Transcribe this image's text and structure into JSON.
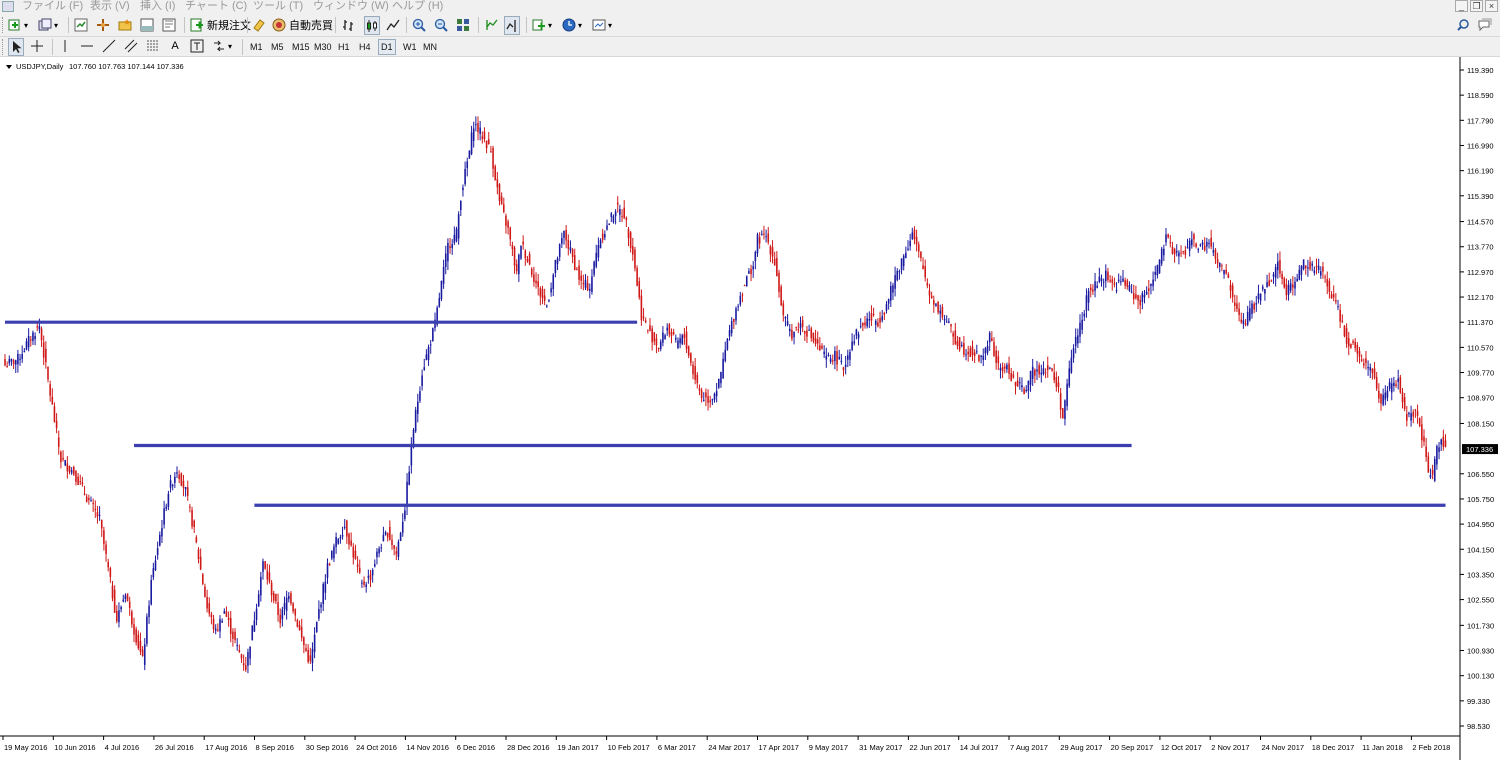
{
  "menu": {
    "items": [
      "ファイル (F)",
      "表示 (V)",
      "挿入 (I)",
      "チャート (C)",
      "ツール (T)",
      "ウィンドウ (W)",
      "ヘルプ (H)"
    ]
  },
  "toolbar": {
    "new_order_label": "新規注文",
    "auto_trade_label": "自動売買",
    "timeframes": [
      "M1",
      "M5",
      "M15",
      "M30",
      "H1",
      "H4",
      "D1",
      "W1",
      "MN"
    ],
    "active_timeframe": "D1"
  },
  "chart_header": {
    "symbol_text": "USDJPY,Daily",
    "ohlc_text": "107.760 107.763 107.144 107.336"
  },
  "colors": {
    "bull": "#1a1aa0",
    "bear": "#d01818",
    "level_line": "#3b3fb0",
    "price_label_bg": "#000000"
  },
  "chart_data": {
    "type": "candlestick",
    "symbol": "USDJPY",
    "timeframe": "Daily",
    "last_price": 107.336,
    "y_ticks": [
      119.39,
      118.59,
      117.79,
      116.99,
      116.19,
      115.39,
      114.57,
      113.77,
      112.97,
      112.17,
      111.37,
      110.57,
      109.77,
      108.97,
      108.15,
      107.336,
      106.55,
      105.75,
      104.95,
      104.15,
      103.35,
      102.55,
      101.73,
      100.93,
      100.13,
      99.33,
      98.53
    ],
    "y_tick_labels": [
      "119.390",
      "118.590",
      "117.790",
      "116.990",
      "116.190",
      "115.390",
      "114.570",
      "113.770",
      "112.970",
      "112.170",
      "111.370",
      "110.570",
      "109.770",
      "108.970",
      "108.150",
      "107.336",
      "106.550",
      "105.750",
      "104.950",
      "104.150",
      "103.350",
      "102.550",
      "101.730",
      "100.930",
      "100.130",
      "99.330",
      "98.530"
    ],
    "x_labels": [
      "19 May 2016",
      "10 Jun 2016",
      "4 Jul 2016",
      "26 Jul 2016",
      "17 Aug 2016",
      "8 Sep 2016",
      "30 Sep 2016",
      "24 Oct 2016",
      "14 Nov 2016",
      "6 Dec 2016",
      "28 Dec 2016",
      "19 Jan 2017",
      "10 Feb 2017",
      "6 Mar 2017",
      "24 Mar 2017",
      "17 Apr 2017",
      "9 May 2017",
      "31 May 2017",
      "22 Jun 2017",
      "14 Jul 2017",
      "7 Aug 2017",
      "29 Aug 2017",
      "20 Sep 2017",
      "12 Oct 2017",
      "2 Nov 2017",
      "24 Nov 2017",
      "18 Dec 2017",
      "11 Jan 2018",
      "2 Feb 2018"
    ],
    "ylim": [
      98.53,
      119.39
    ],
    "path_points": [
      [
        0,
        110.0
      ],
      [
        6,
        110.2
      ],
      [
        12,
        110.9
      ],
      [
        16,
        111.25
      ],
      [
        20,
        109.5
      ],
      [
        26,
        107.0
      ],
      [
        32,
        106.6
      ],
      [
        38,
        105.8
      ],
      [
        44,
        105.1
      ],
      [
        48,
        103.5
      ],
      [
        52,
        101.9
      ],
      [
        56,
        102.8
      ],
      [
        60,
        101.6
      ],
      [
        64,
        100.6
      ],
      [
        68,
        103.1
      ],
      [
        72,
        104.6
      ],
      [
        76,
        106.0
      ],
      [
        80,
        106.7
      ],
      [
        84,
        106.0
      ],
      [
        88,
        104.7
      ],
      [
        94,
        102.3
      ],
      [
        98,
        101.5
      ],
      [
        102,
        102.2
      ],
      [
        108,
        101.0
      ],
      [
        112,
        100.4
      ],
      [
        116,
        102.0
      ],
      [
        120,
        103.7
      ],
      [
        124,
        102.8
      ],
      [
        128,
        101.9
      ],
      [
        132,
        102.8
      ],
      [
        138,
        101.3
      ],
      [
        142,
        100.5
      ],
      [
        146,
        102.2
      ],
      [
        150,
        103.6
      ],
      [
        154,
        104.4
      ],
      [
        158,
        104.9
      ],
      [
        162,
        104.0
      ],
      [
        166,
        103.0
      ],
      [
        170,
        103.3
      ],
      [
        174,
        104.2
      ],
      [
        178,
        104.7
      ],
      [
        182,
        104.0
      ],
      [
        186,
        105.5
      ],
      [
        190,
        108.0
      ],
      [
        194,
        109.8
      ],
      [
        196,
        110.3
      ],
      [
        200,
        111.3
      ],
      [
        203,
        112.6
      ],
      [
        206,
        113.8
      ],
      [
        210,
        114.2
      ],
      [
        212,
        115.4
      ],
      [
        216,
        116.8
      ],
      [
        218,
        117.7
      ],
      [
        222,
        117.3
      ],
      [
        226,
        116.8
      ],
      [
        230,
        115.2
      ],
      [
        234,
        114.3
      ],
      [
        238,
        112.9
      ],
      [
        240,
        113.9
      ],
      [
        244,
        113.2
      ],
      [
        248,
        112.4
      ],
      [
        252,
        111.9
      ],
      [
        256,
        113.2
      ],
      [
        260,
        114.2
      ],
      [
        264,
        113.4
      ],
      [
        268,
        112.6
      ],
      [
        272,
        112.5
      ],
      [
        276,
        113.9
      ],
      [
        280,
        114.4
      ],
      [
        284,
        115.0
      ],
      [
        288,
        114.8
      ],
      [
        292,
        113.6
      ],
      [
        296,
        111.6
      ],
      [
        300,
        111.0
      ],
      [
        304,
        110.6
      ],
      [
        308,
        111.2
      ],
      [
        312,
        110.7
      ],
      [
        316,
        110.9
      ],
      [
        320,
        109.8
      ],
      [
        324,
        109.0
      ],
      [
        328,
        108.9
      ],
      [
        332,
        109.4
      ],
      [
        336,
        110.8
      ],
      [
        340,
        111.8
      ],
      [
        344,
        112.6
      ],
      [
        348,
        113.2
      ],
      [
        350,
        114.0
      ],
      [
        354,
        114.1
      ],
      [
        358,
        113.3
      ],
      [
        362,
        111.5
      ],
      [
        366,
        111.0
      ],
      [
        370,
        111.3
      ],
      [
        374,
        111.0
      ],
      [
        378,
        110.6
      ],
      [
        382,
        110.2
      ],
      [
        386,
        110.3
      ],
      [
        390,
        109.9
      ],
      [
        394,
        110.8
      ],
      [
        398,
        111.2
      ],
      [
        402,
        111.5
      ],
      [
        406,
        111.4
      ],
      [
        410,
        111.9
      ],
      [
        414,
        112.8
      ],
      [
        418,
        113.5
      ],
      [
        422,
        114.2
      ],
      [
        426,
        113.3
      ],
      [
        430,
        112.3
      ],
      [
        434,
        111.8
      ],
      [
        438,
        111.4
      ],
      [
        442,
        110.8
      ],
      [
        446,
        110.5
      ],
      [
        450,
        110.4
      ],
      [
        454,
        110.2
      ],
      [
        458,
        110.9
      ],
      [
        462,
        109.9
      ],
      [
        466,
        109.9
      ],
      [
        470,
        109.4
      ],
      [
        474,
        109.2
      ],
      [
        478,
        109.8
      ],
      [
        482,
        109.9
      ],
      [
        486,
        109.9
      ],
      [
        490,
        109.2
      ],
      [
        492,
        108.3
      ],
      [
        496,
        110.3
      ],
      [
        500,
        111.3
      ],
      [
        504,
        112.3
      ],
      [
        508,
        112.6
      ],
      [
        512,
        112.9
      ],
      [
        516,
        112.5
      ],
      [
        520,
        112.7
      ],
      [
        524,
        112.3
      ],
      [
        528,
        112.0
      ],
      [
        532,
        112.5
      ],
      [
        536,
        113.1
      ],
      [
        540,
        114.0
      ],
      [
        544,
        113.6
      ],
      [
        548,
        113.5
      ],
      [
        552,
        114.0
      ],
      [
        556,
        113.7
      ],
      [
        560,
        113.9
      ],
      [
        564,
        113.2
      ],
      [
        568,
        112.9
      ],
      [
        572,
        111.9
      ],
      [
        576,
        111.3
      ],
      [
        580,
        111.8
      ],
      [
        584,
        112.3
      ],
      [
        588,
        112.7
      ],
      [
        592,
        113.2
      ],
      [
        596,
        112.4
      ],
      [
        600,
        112.6
      ],
      [
        604,
        113.3
      ],
      [
        608,
        113.1
      ],
      [
        612,
        113.0
      ],
      [
        616,
        112.4
      ],
      [
        620,
        111.8
      ],
      [
        624,
        110.8
      ],
      [
        628,
        110.6
      ],
      [
        632,
        110.1
      ],
      [
        636,
        109.8
      ],
      [
        640,
        108.8
      ],
      [
        644,
        109.3
      ],
      [
        648,
        109.5
      ],
      [
        652,
        108.3
      ],
      [
        656,
        108.5
      ],
      [
        660,
        107.4
      ],
      [
        662,
        106.6
      ],
      [
        664,
        106.5
      ],
      [
        666,
        107.3
      ],
      [
        668,
        107.8
      ],
      [
        670,
        107.3
      ]
    ],
    "levels": [
      {
        "price": 111.37,
        "x_start": 0,
        "x_end": 294
      },
      {
        "price": 107.45,
        "x_start": 60,
        "x_end": 524
      },
      {
        "price": 105.55,
        "x_start": 116,
        "x_end": 670
      }
    ]
  }
}
